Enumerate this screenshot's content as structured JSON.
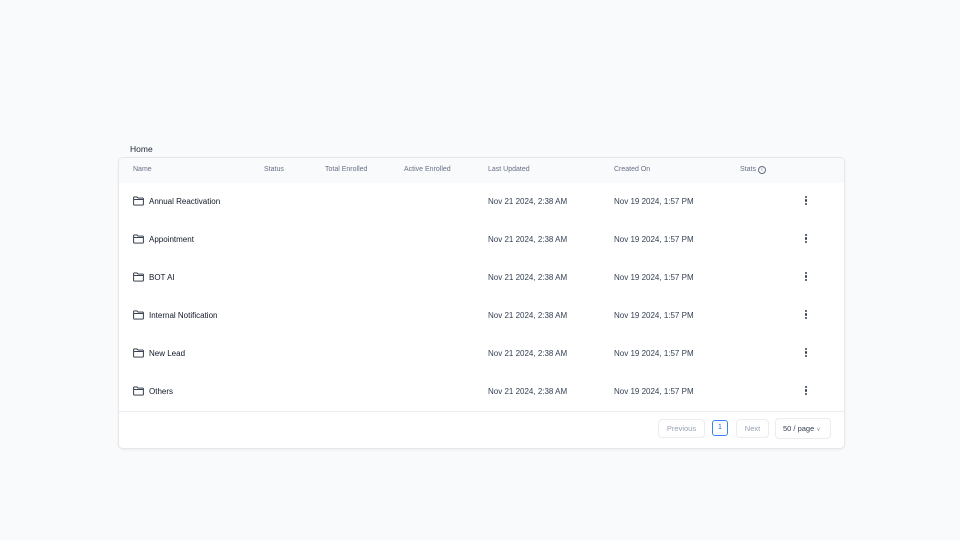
{
  "breadcrumb": "Home",
  "table": {
    "columns": [
      "Name",
      "Status",
      "Total Enrolled",
      "Active Enrolled",
      "Last Updated",
      "Created On",
      "Stats"
    ],
    "rows": [
      {
        "name": "Annual Reactivation",
        "status": "",
        "total_enrolled": "",
        "active_enrolled": "",
        "last_updated": "Nov 21 2024, 2:38 AM",
        "created_on": "Nov 19 2024, 1:57 PM"
      },
      {
        "name": "Appointment",
        "status": "",
        "total_enrolled": "",
        "active_enrolled": "",
        "last_updated": "Nov 21 2024, 2:38 AM",
        "created_on": "Nov 19 2024, 1:57 PM"
      },
      {
        "name": "BOT AI",
        "status": "",
        "total_enrolled": "",
        "active_enrolled": "",
        "last_updated": "Nov 21 2024, 2:38 AM",
        "created_on": "Nov 19 2024, 1:57 PM"
      },
      {
        "name": "Internal Notification",
        "status": "",
        "total_enrolled": "",
        "active_enrolled": "",
        "last_updated": "Nov 21 2024, 2:38 AM",
        "created_on": "Nov 19 2024, 1:57 PM"
      },
      {
        "name": "New Lead",
        "status": "",
        "total_enrolled": "",
        "active_enrolled": "",
        "last_updated": "Nov 21 2024, 2:38 AM",
        "created_on": "Nov 19 2024, 1:57 PM"
      },
      {
        "name": "Others",
        "status": "",
        "total_enrolled": "",
        "active_enrolled": "",
        "last_updated": "Nov 21 2024, 2:38 AM",
        "created_on": "Nov 19 2024, 1:57 PM"
      }
    ]
  },
  "pagination": {
    "previous_label": "Previous",
    "current_page": "1",
    "next_label": "Next",
    "page_size": "50 / page"
  },
  "icons": {
    "row_icon": "folder-icon",
    "row_action": "more-vertical-icon",
    "stats_info": "info-icon",
    "page_size_dropdown": "chevron-down-icon"
  },
  "colors": {
    "background": "#f9fafb",
    "active_page": "#3b82f6"
  }
}
